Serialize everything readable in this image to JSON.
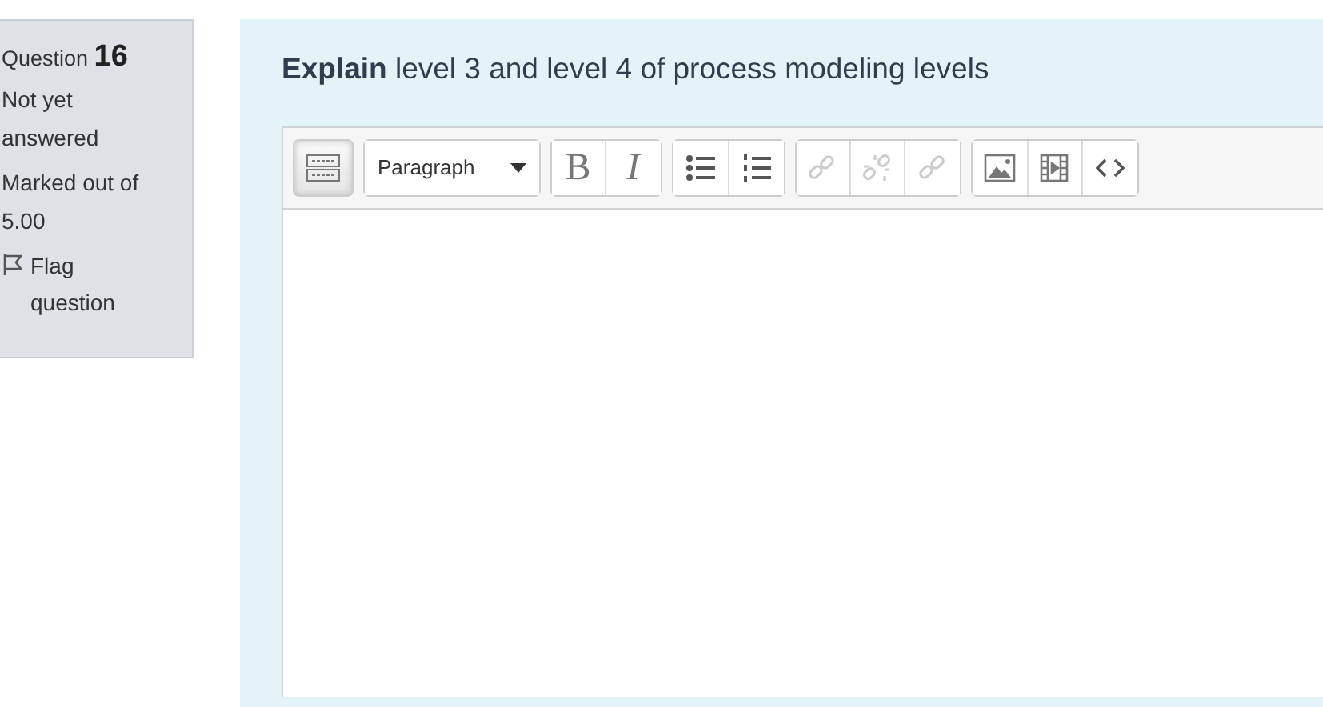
{
  "question_info": {
    "label": "Question",
    "number": "16",
    "state": "Not yet answered",
    "grade": "Marked out of 5.00",
    "flag": {
      "label": "Flag question",
      "flagged": false
    }
  },
  "question": {
    "text": "**Explain** level 3 and level 4 of process modeling levels"
  },
  "editor": {
    "toolbar": [
      {
        "buttons": [
          {
            "kind": "toggle",
            "pressed": true,
            "disabled": false
          }
        ]
      },
      {
        "buttons": [
          {
            "kind": "dropdown",
            "label": "Paragraph",
            "pressed": false,
            "disabled": false
          }
        ]
      },
      {
        "buttons": [
          {
            "kind": "bold",
            "label": "B",
            "pressed": false,
            "disabled": false
          },
          {
            "kind": "italic",
            "label": "I",
            "pressed": false,
            "disabled": false
          }
        ]
      },
      {
        "buttons": [
          {
            "kind": "bullets",
            "pressed": false,
            "disabled": false
          },
          {
            "kind": "numbers",
            "pressed": false,
            "disabled": false
          }
        ]
      },
      {
        "buttons": [
          {
            "kind": "link",
            "pressed": false,
            "disabled": true
          },
          {
            "kind": "unlink",
            "pressed": false,
            "disabled": true
          },
          {
            "kind": "link",
            "pressed": false,
            "disabled": true
          }
        ]
      },
      {
        "buttons": [
          {
            "kind": "image",
            "pressed": false,
            "disabled": false
          },
          {
            "kind": "media",
            "pressed": false,
            "disabled": false
          },
          {
            "kind": "html",
            "pressed": false,
            "disabled": false
          }
        ]
      }
    ]
  }
}
